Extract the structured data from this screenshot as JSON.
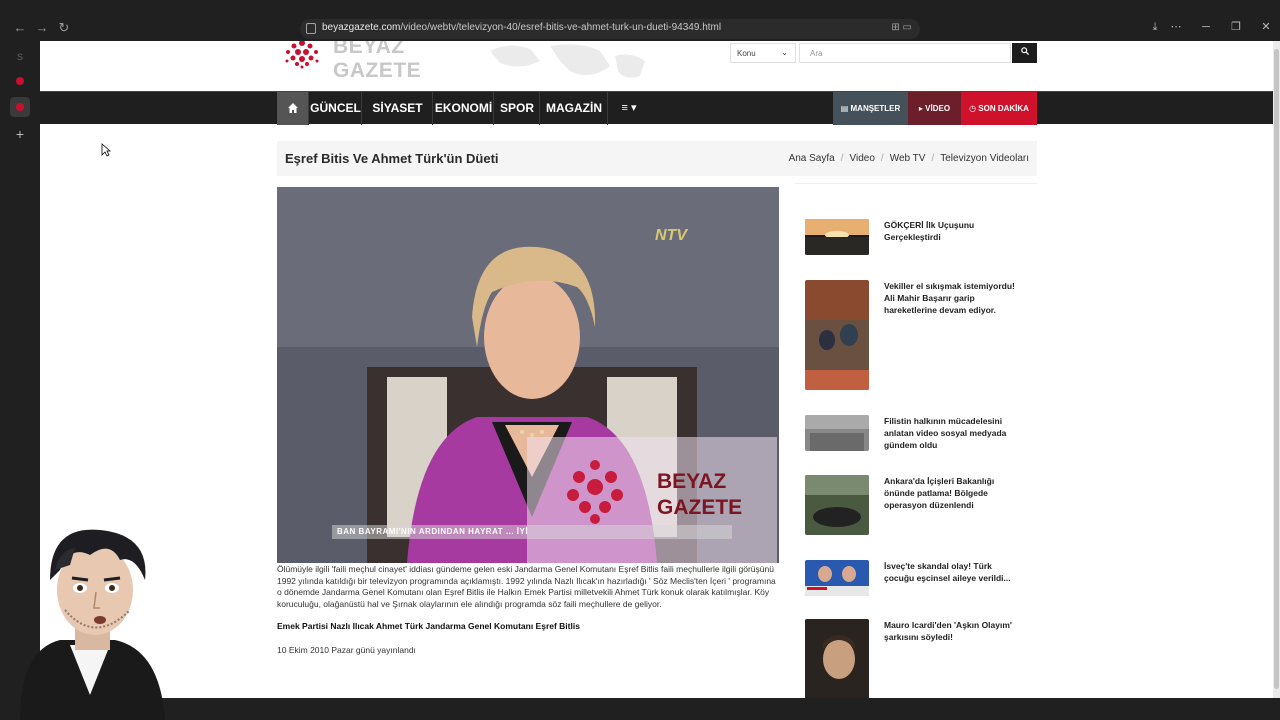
{
  "browser": {
    "url_host": "beyazgazete.com",
    "url_path": "/video/webtv/televizyon-40/esref-bitis-ve-ahmet-turk-un-dueti-94349.html"
  },
  "site": {
    "logo_text": "BEYAZ GAZETE",
    "konu_label": "Konu",
    "search_placeholder": "Ara"
  },
  "nav": {
    "items": [
      "GÜNCEL",
      "SİYASET",
      "EKONOMİ",
      "SPOR",
      "MAGAZİN"
    ],
    "mansetler": "MANŞETLER",
    "video": "VİDEO",
    "son_dakika": "SON DAKİKA"
  },
  "page": {
    "title": "Eşref Bitis Ve Ahmet Türk'ün Düeti",
    "breadcrumbs": [
      "Ana Sayfa",
      "Video",
      "Web TV",
      "Televizyon Videoları"
    ]
  },
  "video": {
    "channel_logo": "NTV",
    "ticker": "BAN BAYRAMI'NIN ARDINDAN HAYRAT ... İYİ",
    "watermark_line1": "BEYAZ",
    "watermark_line2": "GAZETE"
  },
  "article": {
    "description": "Ölümüyle ilgili 'faili meçhul cinayet' iddiası gündeme gelen eski Jandarma Genel Komutanı Eşref Bitlis faili meçhullerle ilgili görüşünü 1992 yılında katıldığı bir televizyon programında açıklamıştı. 1992 yılında Nazlı Ilıcak'ın hazırladığı ' Söz Meclis'ten İçeri ' programına o dönemde Jandarma Genel Komutanı olan Eşref Bitlis ile Halkın Emek Partisi milletvekili Ahmet Türk konuk olarak katılmışlar. Köy koruculuğu, olağanüstü hal ve Şırnak olaylarının ele alındığı programda söz faili meçhullere de geliyor.",
    "tags": "Emek Partisi Nazlı Ilıcak Ahmet Türk Jandarma Genel Komutanı Eşref Bitlis",
    "date": "10 Ekim 2010 Pazar günü yayınlandı"
  },
  "sidebar": {
    "items": [
      {
        "title": "GÖKÇERİ İlk Uçuşunu Gerçekleştirdi"
      },
      {
        "title": "Vekiller el sıkışmak istemiyordu! Ali Mahir Başarır garip hareketlerine devam ediyor."
      },
      {
        "title": "Filistin halkının mücadelesini anlatan video sosyal medyada gündem oldu"
      },
      {
        "title": "Ankara'da İçişleri Bakanlığı önünde patlama! Bölgede operasyon düzenlendi"
      },
      {
        "title": "İsveç'te skandal olay! Türk çocuğu eşcinsel aileye verildi..."
      },
      {
        "title": "Mauro Icardi'den 'Aşkın Olayım' şarkısını söyledi!"
      }
    ]
  }
}
